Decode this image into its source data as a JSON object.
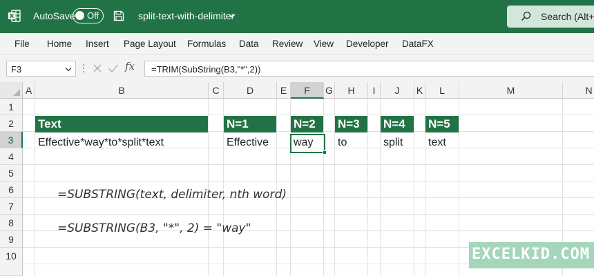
{
  "titlebar": {
    "app_icon": "excel-icon",
    "autosave_label": "AutoSave",
    "autosave_state": "Off",
    "save_icon": "save-icon",
    "document_title": "split-text-with-delimiter",
    "search_placeholder": "Search (Alt+Q)",
    "accent_color": "#217346"
  },
  "menu": {
    "items": [
      "File",
      "Home",
      "Insert",
      "Page Layout",
      "Formulas",
      "Data",
      "Review",
      "View",
      "Developer",
      "DataFX"
    ]
  },
  "formula_bar": {
    "name_box": "F3",
    "formula": "=TRIM(SubString(B3,\"*\",2))",
    "fx_label": "fx"
  },
  "sheet": {
    "columns": [
      "A",
      "B",
      "C",
      "D",
      "E",
      "F",
      "G",
      "H",
      "I",
      "J",
      "K",
      "L",
      "M",
      "N"
    ],
    "rows": [
      "1",
      "2",
      "3",
      "4",
      "5",
      "6",
      "7",
      "8",
      "9",
      "10"
    ],
    "selected_column": "F",
    "selected_row": "3",
    "headers": {
      "B2": "Text",
      "D2": "N=1",
      "F2": "N=2",
      "H2": "N=3",
      "J2": "N=4",
      "L2": "N=5"
    },
    "values": {
      "B3": "Effective*way*to*split*text",
      "D3": "Effective",
      "F3": "way",
      "H3": "to",
      "J3": "split",
      "L3": "text"
    },
    "notes": {
      "syntax": "=SUBSTRING(text, delimiter, nth word)",
      "example": "=SUBSTRING(B3, \"*\", 2) = \"way\""
    }
  },
  "watermark": "EXCELKID.COM"
}
